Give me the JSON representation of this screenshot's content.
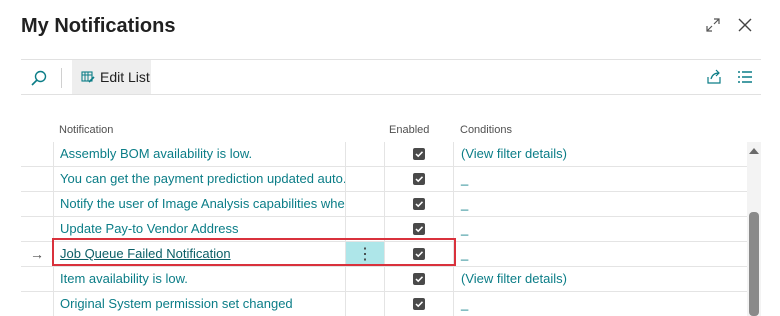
{
  "window": {
    "title": "My Notifications",
    "expand_icon": "expand-icon",
    "close_icon": "close-icon"
  },
  "toolbar": {
    "search_icon": "search-icon",
    "edit_list_label": "Edit List",
    "edit_list_icon": "edit-list-icon",
    "share_icon": "share-icon",
    "list_view_icon": "list-view-icon"
  },
  "columns": {
    "notification": "Notification",
    "enabled": "Enabled",
    "conditions": "Conditions"
  },
  "rows": [
    {
      "notification": "Assembly BOM availability is low.",
      "enabled": true,
      "conditions": "(View filter details)"
    },
    {
      "notification": "You can get the payment prediction updated auto...",
      "enabled": true,
      "conditions": "_"
    },
    {
      "notification": "Notify the user of Image Analysis capabilities whe...",
      "enabled": true,
      "conditions": "_"
    },
    {
      "notification": "Update Pay-to Vendor Address",
      "enabled": true,
      "conditions": "_"
    },
    {
      "notification": "Job Queue Failed Notification",
      "enabled": true,
      "conditions": "_",
      "selected": true
    },
    {
      "notification": "Item availability is low.",
      "enabled": true,
      "conditions": "(View filter details)"
    },
    {
      "notification": "Original System permission set changed",
      "enabled": true,
      "conditions": "_"
    }
  ],
  "selected_row_arrow": "→",
  "row_menu_glyph": "⋮",
  "colors": {
    "accent_link": "#0b7d87",
    "selection_highlight": "#aee6e9",
    "selection_outline": "#d9313c",
    "toolbar_active_bg": "#eeeeee"
  }
}
